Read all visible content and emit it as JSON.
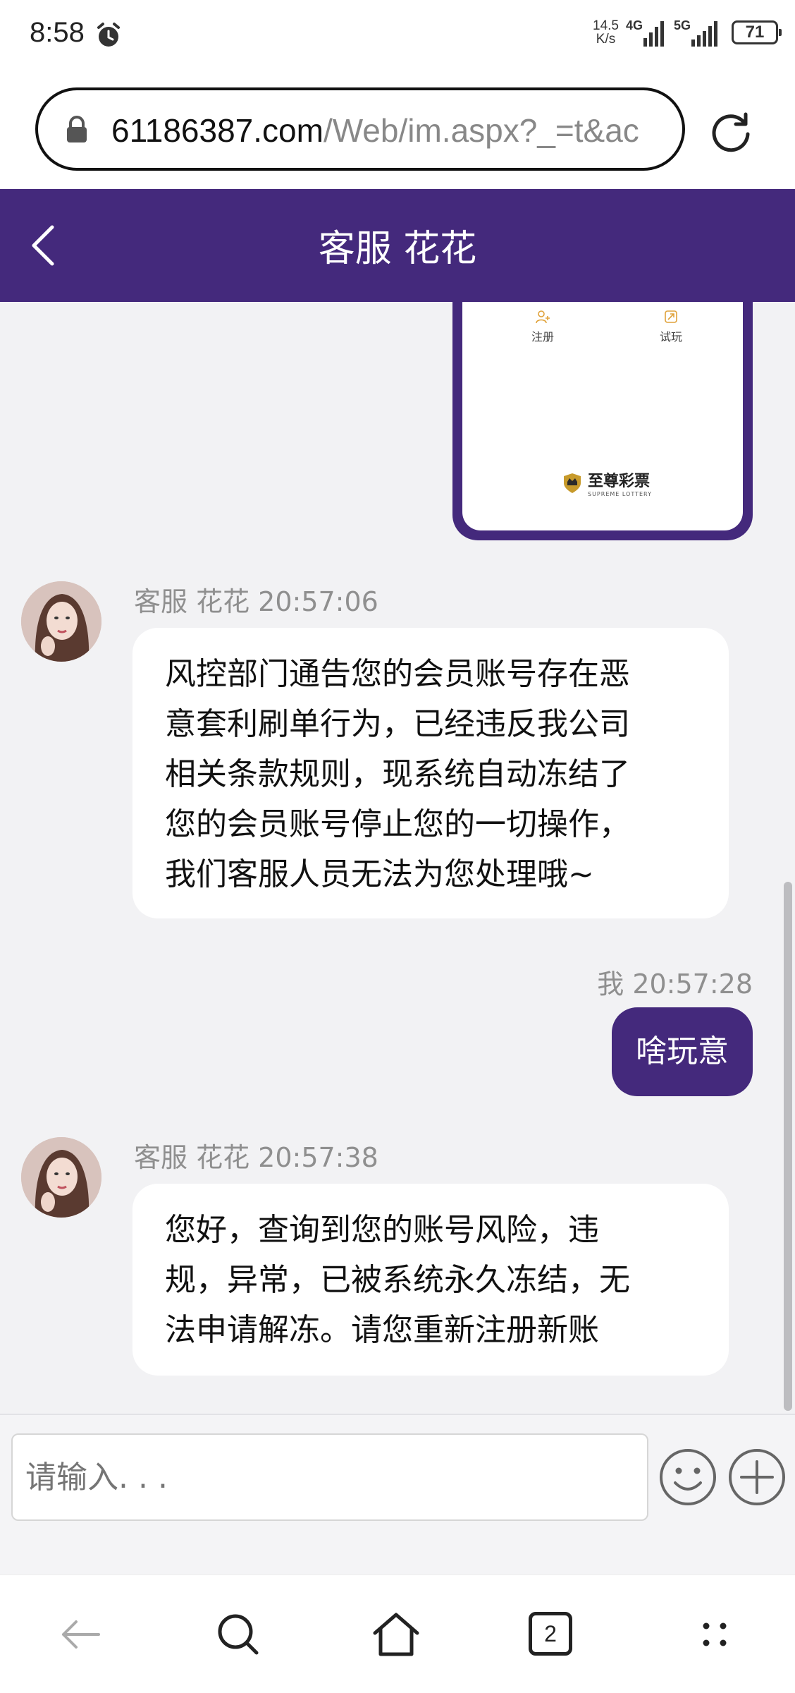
{
  "status_bar": {
    "time": "8:58",
    "net_speed_value": "14.5",
    "net_speed_unit": "K/s",
    "signal1_label": "4G",
    "signal2_label": "5G",
    "battery": "71"
  },
  "browser": {
    "url_host": "61186387.com",
    "url_path": "/Web/im.aspx?_=t&ac",
    "tab_count": "2"
  },
  "chat": {
    "title": "客服 花花",
    "screenshot_card": {
      "item1": "注册",
      "item2": "试玩",
      "logo_text": "至尊彩票",
      "logo_subtext": "SUPREME LOTTERY"
    },
    "messages": [
      {
        "sender": "客服 花花",
        "time": "20:57:06",
        "meta": "客服 花花 20:57:06",
        "lines": [
          "风控部门通告您的会员账号存在恶",
          "意套利刷单行为，已经违反我公司",
          "相关条款规则，现系统自动冻结了",
          "您的会员账号停止您的一切操作，",
          "我们客服人员无法为您处理哦~"
        ]
      },
      {
        "sender": "我",
        "time": "20:57:28",
        "meta": "我 20:57:28",
        "text": "啥玩意"
      },
      {
        "sender": "客服 花花",
        "time": "20:57:38",
        "meta": "客服 花花 20:57:38",
        "lines": [
          "您好，查询到您的账号风险，违",
          "规，异常，已被系统永久冻结，无",
          "法申请解冻。请您重新注册新账"
        ]
      }
    ],
    "input_placeholder": "请输入. . ."
  },
  "colors": {
    "accent": "#44297c",
    "chat_background": "#f2f2f4"
  }
}
